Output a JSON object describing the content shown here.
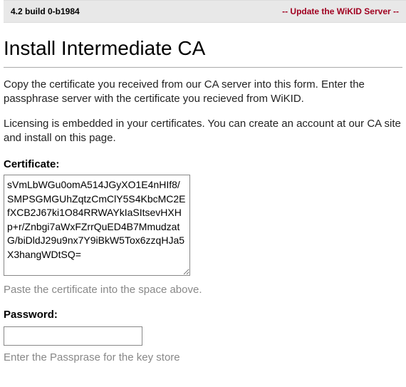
{
  "topbar": {
    "version": "4.2 build 0-b1984",
    "update_link": "-- Update the WiKID Server --"
  },
  "page": {
    "title": "Install Intermediate CA",
    "para1": "Copy the certificate you received from our CA server into this form. Enter the passphrase server with the certificate you recieved from WiKID.",
    "para2": "Licensing is embedded in your certificates. You can create an account at our CA site and install on this page."
  },
  "form": {
    "cert_label": "Certificate:",
    "cert_value": "sVmLbWGu0omA514JGyXO1E4nHIf8/SMPSGMGUhZqtzCmClY5S4KbcMC2EfXCB2J67ki1O84RRWAYkIaSItsevHXHp+r/Znbgi7aWxFZrrQuED4B7MmudzatG/biDldJ29u9nx7Y9iBkW5Tox6zzqHJa5X3hangWDtSQ=",
    "cert_hint": "Paste the certificate into the space above.",
    "pwd_label": "Password:",
    "pwd_value": "",
    "pwd_hint": "Enter the Passprase for the key store"
  }
}
